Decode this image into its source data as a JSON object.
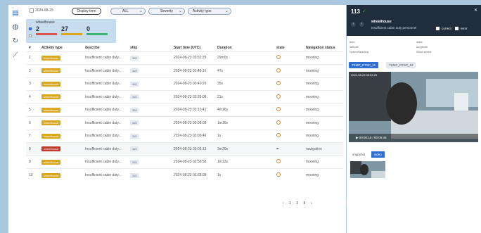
{
  "topbar": {
    "date": "2024-08-23",
    "display_time_label": "Display time",
    "filters": [
      {
        "label": "ALL"
      },
      {
        "label": "Severity"
      },
      {
        "label": "Activity type"
      }
    ]
  },
  "summary": {
    "title": "wheelhouse",
    "counts": [
      {
        "value": "2",
        "color": "#d9534f"
      },
      {
        "value": "27",
        "color": "#d8a820"
      },
      {
        "value": "0",
        "color": "#3cb371"
      }
    ]
  },
  "table": {
    "headers": [
      "#",
      "Activity type",
      "describe",
      "ship",
      "Start time [UTC]",
      "Duration",
      "state",
      "Navigation status"
    ],
    "rows": [
      {
        "n": "1",
        "type": "wheelhouse",
        "severity": "warn",
        "describe": "Insufficient cabin duty...",
        "ship": "113",
        "start": "2024-08-23 03:52:29",
        "duration": "29m0s",
        "state": "alarm",
        "nav": "mooring"
      },
      {
        "n": "2",
        "type": "wheelhouse",
        "severity": "warn",
        "describe": "Insufficient cabin duty...",
        "ship": "113",
        "start": "2024-08-23 03:48:16",
        "duration": "47s",
        "state": "alarm",
        "nav": "mooring"
      },
      {
        "n": "3",
        "type": "wheelhouse",
        "severity": "warn",
        "describe": "Insufficient cabin duty...",
        "ship": "113",
        "start": "2024-08-23 03:40:29",
        "duration": "35s",
        "state": "alarm",
        "nav": "mooring"
      },
      {
        "n": "4",
        "type": "wheelhouse",
        "severity": "warn",
        "describe": "Insufficient cabin duty...",
        "ship": "113",
        "start": "2024-08-23 03:35:08",
        "duration": "21s",
        "state": "alarm",
        "nav": "mooring"
      },
      {
        "n": "5",
        "type": "wheelhouse",
        "severity": "warn",
        "describe": "Insufficient cabin duty...",
        "ship": "113",
        "start": "2024-08-23 03:10:41",
        "duration": "4m16s",
        "state": "alarm",
        "nav": "mooring"
      },
      {
        "n": "6",
        "type": "wheelhouse",
        "severity": "warn",
        "describe": "Insufficient cabin duty...",
        "ship": "113",
        "start": "2024-08-23 03:08:08",
        "duration": "1m16s",
        "state": "alarm",
        "nav": "mooring"
      },
      {
        "n": "7",
        "type": "wheelhouse",
        "severity": "warn",
        "describe": "Insufficient cabin duty...",
        "ship": "113",
        "start": "2024-08-23 03:06:46",
        "duration": "1s",
        "state": "alarm",
        "nav": "mooring"
      },
      {
        "n": "8",
        "type": "wheelhouse",
        "severity": "critical",
        "describe": "Insufficient cabin duty...",
        "ship": "113",
        "start": "2024-08-23 03:02:13",
        "duration": "3m30s",
        "state": "gps",
        "nav": "navigation"
      },
      {
        "n": "9",
        "type": "wheelhouse",
        "severity": "warn",
        "describe": "Insufficient cabin duty...",
        "ship": "113",
        "start": "2024-08-23 02:58:58",
        "duration": "1m13s",
        "state": "alarm",
        "nav": "mooring"
      },
      {
        "n": "10",
        "type": "wheelhouse",
        "severity": "warn",
        "describe": "Insufficient cabin duty...",
        "ship": "113",
        "start": "2024-08-23 02:58:08",
        "duration": "1s",
        "state": "alarm",
        "nav": "mooring"
      }
    ]
  },
  "pager": {
    "pages": [
      "1",
      "2",
      "3"
    ],
    "current_page": "1",
    "prev": "‹",
    "next": "›"
  },
  "detail": {
    "ship": "113",
    "title": "wheelhouse",
    "subtitle": "Insufficient cabin duty personnel",
    "checks": [
      {
        "label": "correct"
      },
      {
        "label": "error"
      }
    ],
    "info": {
      "time": "time",
      "state": "state",
      "latitude": "latitude",
      "longitude": "longitude",
      "speed": "Speed/heading",
      "wind": "Wind speed"
    },
    "cameras": [
      {
        "label": "TEMP_RTSP_11",
        "active": true
      },
      {
        "label": "TEMP_RTSP_12",
        "active": false
      }
    ],
    "video_time": "00:00:15 / 00:00:46",
    "video_timestamp": "2024-08-23 03:52:29",
    "media_tabs": [
      {
        "label": "snapshot",
        "active": false
      },
      {
        "label": "video",
        "active": true
      }
    ]
  },
  "colors": {
    "accent": "#2f6fd1",
    "warn": "#d8a820",
    "critical": "#c0392b",
    "panel_header": "#1f2d3d"
  }
}
